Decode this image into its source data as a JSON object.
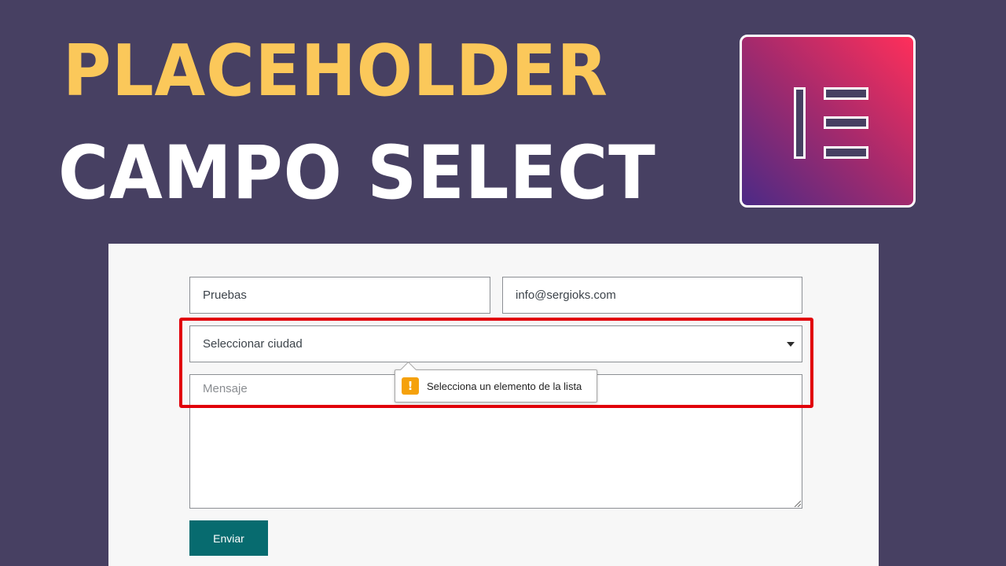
{
  "thumbnail": {
    "title_line1": "PLACEHOLDER",
    "title_line2": "CAMPO SELECT",
    "logo_icon": "elementor-logo-icon"
  },
  "colors": {
    "background": "#474062",
    "title_line1": "#fbc85a",
    "title_line2": "#ffffff",
    "highlight_border": "#e1000a",
    "button": "#076b6f",
    "warning": "#f5a10b"
  },
  "form": {
    "name_value": "Pruebas",
    "email_value": "info@sergioks.com",
    "select_value": "Seleccionar ciudad",
    "message_placeholder": "Mensaje",
    "submit_label": "Enviar"
  },
  "validation": {
    "icon": "warning-icon",
    "icon_glyph": "!",
    "message": "Selecciona un elemento de la lista"
  }
}
